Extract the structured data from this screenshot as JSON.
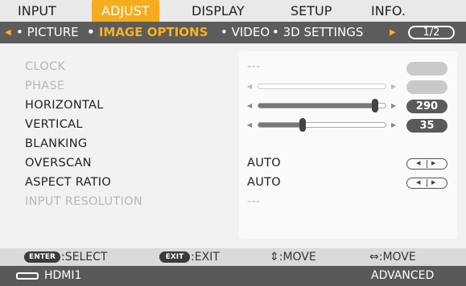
{
  "top_tabs": [
    {
      "label": "INPUT"
    },
    {
      "label": "ADJUST",
      "active": true
    },
    {
      "label": "DISPLAY"
    },
    {
      "label": "SETUP"
    },
    {
      "label": "INFO."
    }
  ],
  "sub_tabs": {
    "picture": "PICTURE",
    "image_options": "IMAGE OPTIONS",
    "video": "VIDEO",
    "settings_3d": "3D SETTINGS",
    "page": "1/2"
  },
  "settings": {
    "clock": {
      "label": "CLOCK",
      "value": "---"
    },
    "phase": {
      "label": "PHASE"
    },
    "horizontal": {
      "label": "HORIZONTAL",
      "value": "290",
      "level": 0.92
    },
    "vertical": {
      "label": "VERTICAL",
      "value": "35",
      "level": 0.35
    },
    "blanking": {
      "label": "BLANKING"
    },
    "overscan": {
      "label": "OVERSCAN",
      "value": "AUTO"
    },
    "aspect_ratio": {
      "label": "ASPECT RATIO",
      "value": "AUTO"
    },
    "input_resolution": {
      "label": "INPUT RESOLUTION",
      "value": "---"
    }
  },
  "bottom_hints": {
    "enter_key": "ENTER",
    "select": ":SELECT",
    "exit_key": "EXIT",
    "exit": ":EXIT",
    "move_v": "⇕:MOVE",
    "move_h": "⇔:MOVE"
  },
  "status": {
    "source": "HDMI1",
    "mode": "ADVANCED"
  },
  "icons": {
    "left_arrow": "triangle-left-icon",
    "right_arrow": "triangle-right-icon",
    "hdmi": "hdmi-icon"
  },
  "colors": {
    "accent": "#f6ac1c",
    "subbar": "#5c5c5c",
    "statusbar": "#595959"
  }
}
